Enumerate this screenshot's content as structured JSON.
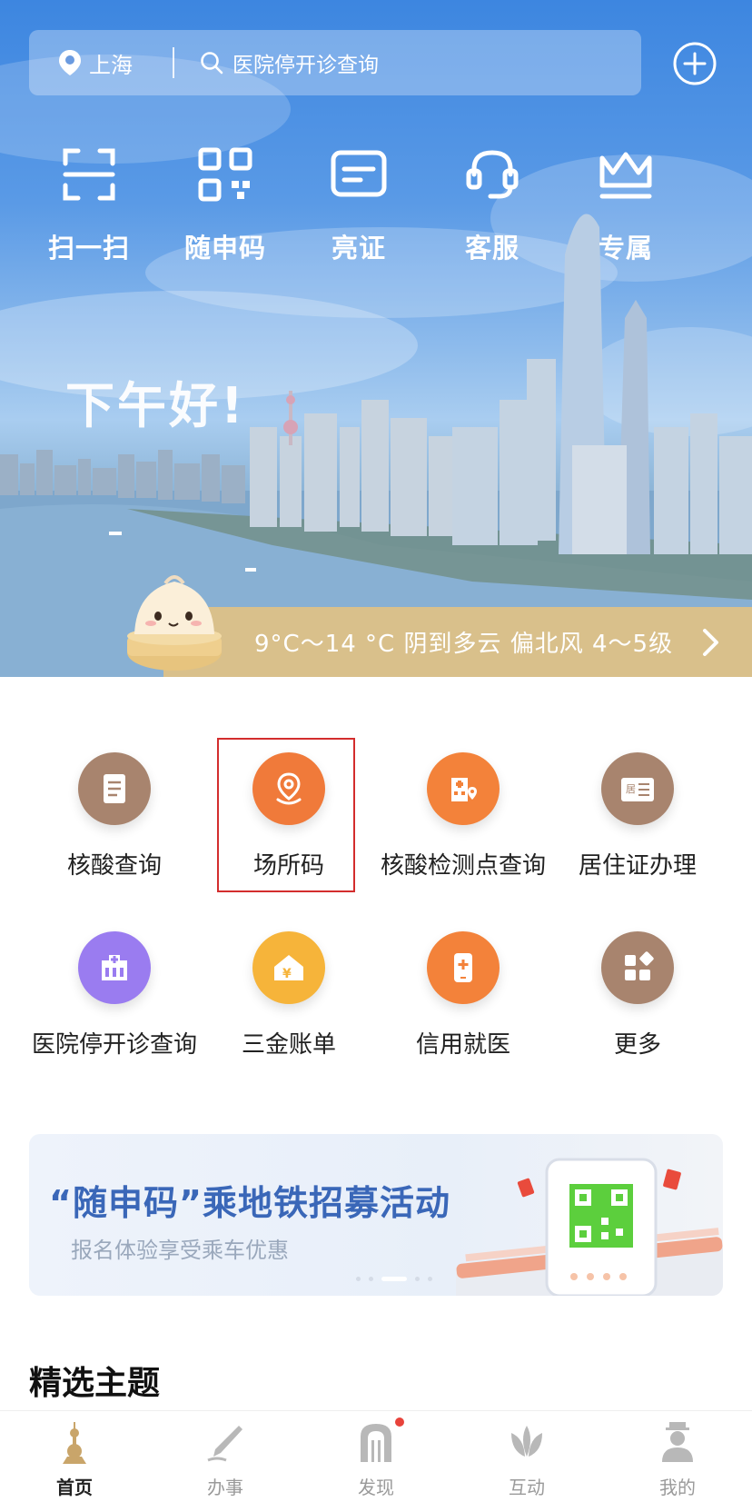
{
  "header": {
    "location": "上海",
    "search_placeholder": "医院停开诊查询"
  },
  "quick_actions": [
    {
      "label": "扫一扫",
      "icon": "scan-icon"
    },
    {
      "label": "随申码",
      "icon": "qr-code-icon"
    },
    {
      "label": "亮证",
      "icon": "id-card-icon"
    },
    {
      "label": "客服",
      "icon": "headset-icon"
    },
    {
      "label": "专属",
      "icon": "crown-icon"
    }
  ],
  "greeting": "下午好!",
  "weather": {
    "text": "9°C～14 °C 阴到多云 偏北风 4～5级"
  },
  "services": [
    {
      "label": "核酸查询",
      "icon": "document-icon",
      "color": "#a8846e"
    },
    {
      "label": "场所码",
      "icon": "location-pin-icon",
      "color": "#f07a3a"
    },
    {
      "label": "核酸检测点查询",
      "icon": "hospital-location-icon",
      "color": "#f3823a"
    },
    {
      "label": "居住证办理",
      "icon": "residence-card-icon",
      "color": "#a8846e"
    },
    {
      "label": "医院停开诊查询",
      "icon": "hospital-icon",
      "color": "#9a7cf0"
    },
    {
      "label": "三金账单",
      "icon": "yuan-house-icon",
      "color": "#f6b43a"
    },
    {
      "label": "信用就医",
      "icon": "phone-medical-icon",
      "color": "#f3823a"
    },
    {
      "label": "更多",
      "icon": "grid-more-icon",
      "color": "#a8846e"
    }
  ],
  "banner": {
    "title": "“随申码”乘地铁招募活动",
    "subtitle": "报名体验享受乘车优惠"
  },
  "section_title": "精选主题",
  "tabs": [
    {
      "label": "首页",
      "icon": "tower-icon"
    },
    {
      "label": "办事",
      "icon": "pen-icon"
    },
    {
      "label": "发现",
      "icon": "arch-icon"
    },
    {
      "label": "互动",
      "icon": "lotus-icon"
    },
    {
      "label": "我的",
      "icon": "person-icon"
    }
  ]
}
